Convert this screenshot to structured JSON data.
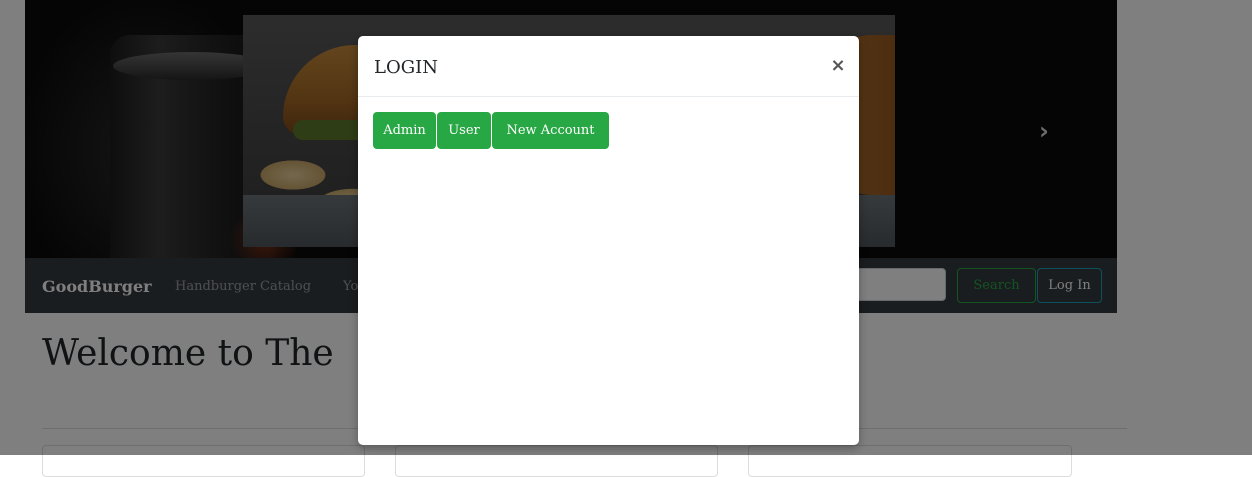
{
  "navbar": {
    "brand": "GoodBurger",
    "links": [
      "Handburger Catalog",
      "Yo"
    ],
    "search_button": "Search",
    "login_button": "Log In"
  },
  "hero": {
    "next_icon": "chevron-right-icon",
    "next_glyph": "›"
  },
  "main": {
    "welcome": "Welcome to The"
  },
  "modal": {
    "title": "LOGIN",
    "close_glyph": "×",
    "buttons": [
      "Admin",
      "User",
      "New Account"
    ]
  },
  "colors": {
    "navbar": "#343a40",
    "success": "#28a745",
    "info": "#17a2b8",
    "backdrop": "rgba(0,0,0,0.5)"
  }
}
